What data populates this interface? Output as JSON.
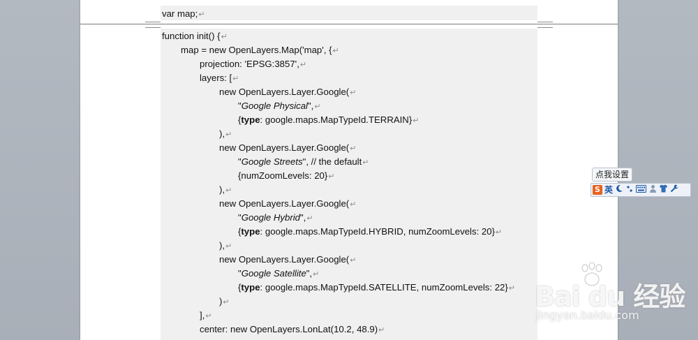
{
  "document": {
    "code_lines": [
      {
        "parts": [
          {
            "t": "var map;"
          }
        ]
      },
      {
        "parts": [
          {
            "t": "function init() {"
          }
        ]
      },
      {
        "parts": [
          {
            "t": "map = new OpenLayers.Map('map', {"
          }
        ]
      },
      {
        "parts": [
          {
            "t": "projection: 'EPSG:3857',"
          }
        ]
      },
      {
        "parts": [
          {
            "t": "layers: ["
          }
        ]
      },
      {
        "parts": [
          {
            "t": "new OpenLayers.Layer.Google("
          }
        ]
      },
      {
        "parts": [
          {
            "t": "\""
          },
          {
            "t": "Google Physical",
            "s": "it"
          },
          {
            "t": "\","
          }
        ]
      },
      {
        "parts": [
          {
            "t": "{"
          },
          {
            "t": "type",
            "s": "b"
          },
          {
            "t": ":  google.maps.MapTypeId.TERRAIN}"
          }
        ]
      },
      {
        "parts": [
          {
            "t": "),"
          }
        ]
      },
      {
        "parts": [
          {
            "t": "new OpenLayers.Layer.Google("
          }
        ]
      },
      {
        "parts": [
          {
            "t": "\""
          },
          {
            "t": "Google Streets",
            "s": "it"
          },
          {
            "t": "\", // the default"
          }
        ]
      },
      {
        "parts": [
          {
            "t": "{numZoomLevels: 20}"
          }
        ]
      },
      {
        "parts": [
          {
            "t": "),"
          }
        ]
      },
      {
        "parts": [
          {
            "t": "new OpenLayers.Layer.Google("
          }
        ]
      },
      {
        "parts": [
          {
            "t": "\""
          },
          {
            "t": "Google Hybrid",
            "s": "it"
          },
          {
            "t": "\","
          }
        ]
      },
      {
        "parts": [
          {
            "t": "{"
          },
          {
            "t": "type",
            "s": "b"
          },
          {
            "t": ":  google.maps.MapTypeId.HYBRID, numZoomLevels: 20}"
          }
        ]
      },
      {
        "parts": [
          {
            "t": "),"
          }
        ]
      },
      {
        "parts": [
          {
            "t": "new OpenLayers.Layer.Google("
          }
        ]
      },
      {
        "parts": [
          {
            "t": "\""
          },
          {
            "t": "Google Satellite",
            "s": "it"
          },
          {
            "t": "\","
          }
        ]
      },
      {
        "parts": [
          {
            "t": "{"
          },
          {
            "t": "type",
            "s": "b"
          },
          {
            "t": ":  google.maps.MapTypeId.SATELLITE, numZoomLevels: 22}"
          }
        ]
      },
      {
        "parts": [
          {
            "t": ")"
          }
        ]
      },
      {
        "parts": [
          {
            "t": "],"
          }
        ]
      },
      {
        "parts": [
          {
            "t": "center:  new OpenLayers.LonLat(10.2, 48.9)"
          }
        ]
      }
    ],
    "paragraph_mark": "↵"
  },
  "ime": {
    "tooltip": "点我设置",
    "logo": "S",
    "mode": "英",
    "icons": [
      "moon-icon",
      "punctuation-icon",
      "keyboard-icon",
      "user-icon",
      "skin-icon",
      "wrench-icon"
    ]
  },
  "watermark": {
    "brand": "Bai du 经验",
    "url": "jingyan.baidu.com"
  },
  "colors": {
    "workspace": "#aeb4bc",
    "code_background": "#f0f0f0",
    "ime_logo": "#e8621f",
    "ime_text": "#1e5aa8"
  }
}
